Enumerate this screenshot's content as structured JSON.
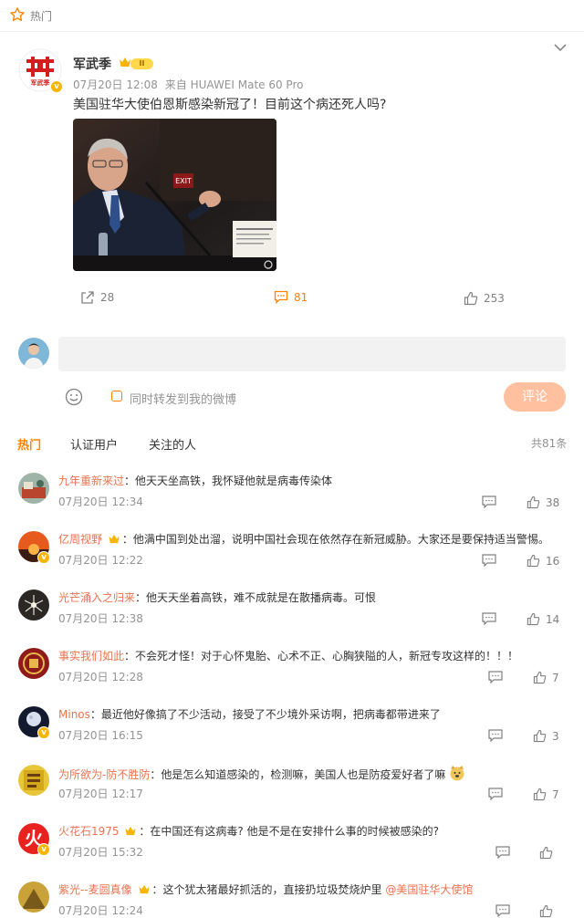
{
  "header": {
    "hot_label": "热门"
  },
  "post": {
    "author": "军武季",
    "avatar_text": "军武季",
    "level": "II",
    "time": "07月20日 12:08",
    "source": "来自 HUAWEI Mate 60 Pro",
    "text": "美国驻华大使伯恩斯感染新冠了！目前这个病还死人吗?",
    "stats": {
      "shares": "28",
      "comments": "81",
      "likes": "253"
    }
  },
  "composer": {
    "placeholder": "",
    "forward_label": "同时转发到我的微博",
    "submit_label": "评论"
  },
  "tabs": {
    "hot": "热门",
    "verified": "认证用户",
    "following": "关注的人"
  },
  "total_label": "共81条",
  "comments": [
    {
      "name": "九年重新来过",
      "sep": "：",
      "text": "他天天坐高铁，我怀疑他就是病毒传染体",
      "time": "07月20日 12:34",
      "likes": "38"
    },
    {
      "name": "亿周视野",
      "sep": "：",
      "text": "他满中国到处出溜，说明中国社会现在依然存在新冠威胁。大家还是要保持适当警惕。",
      "time": "07月20日 12:22",
      "likes": "16"
    },
    {
      "name": "光芒涌入之归来",
      "sep": "：",
      "text": "他天天坐着高铁，难不成就是在散播病毒。可恨",
      "time": "07月20日 12:38",
      "likes": "14"
    },
    {
      "name": "事实我们如此",
      "sep": "：",
      "text": "不会死才怪！对于心怀鬼胎、心术不正、心胸狭隘的人，新冠专攻这样的！！！",
      "time": "07月20日 12:28",
      "likes": "7"
    },
    {
      "name": "Minos",
      "sep": "：",
      "text": "最近他好像搞了不少活动，接受了不少境外采访啊，把病毒都带进来了",
      "time": "07月20日 16:15",
      "likes": "3"
    },
    {
      "name": "为所欲为-防不胜防",
      "sep": "：",
      "text": "他是怎么知道感染的，检测嘛，美国人也是防疫爱好者了嘛",
      "time": "07月20日 12:17",
      "likes": "7"
    },
    {
      "name": "火花石1975",
      "sep": "：",
      "text": "在中国还有这病毒? 他是不是在安排什么事的时候被感染的?",
      "time": "07月20日 15:32",
      "likes": "",
      "avatar_text": "火"
    },
    {
      "name": "紫光--麦圆真像",
      "sep": "：",
      "text": "这个犹太猪最好抓活的，直接扔垃圾焚烧炉里 ",
      "mention": "@美国驻华大使馆",
      "time": "07月20日 12:24",
      "likes": ""
    }
  ],
  "colors": {
    "accent": "#ff8200",
    "name": "#eb7350",
    "meta": "#939393"
  }
}
